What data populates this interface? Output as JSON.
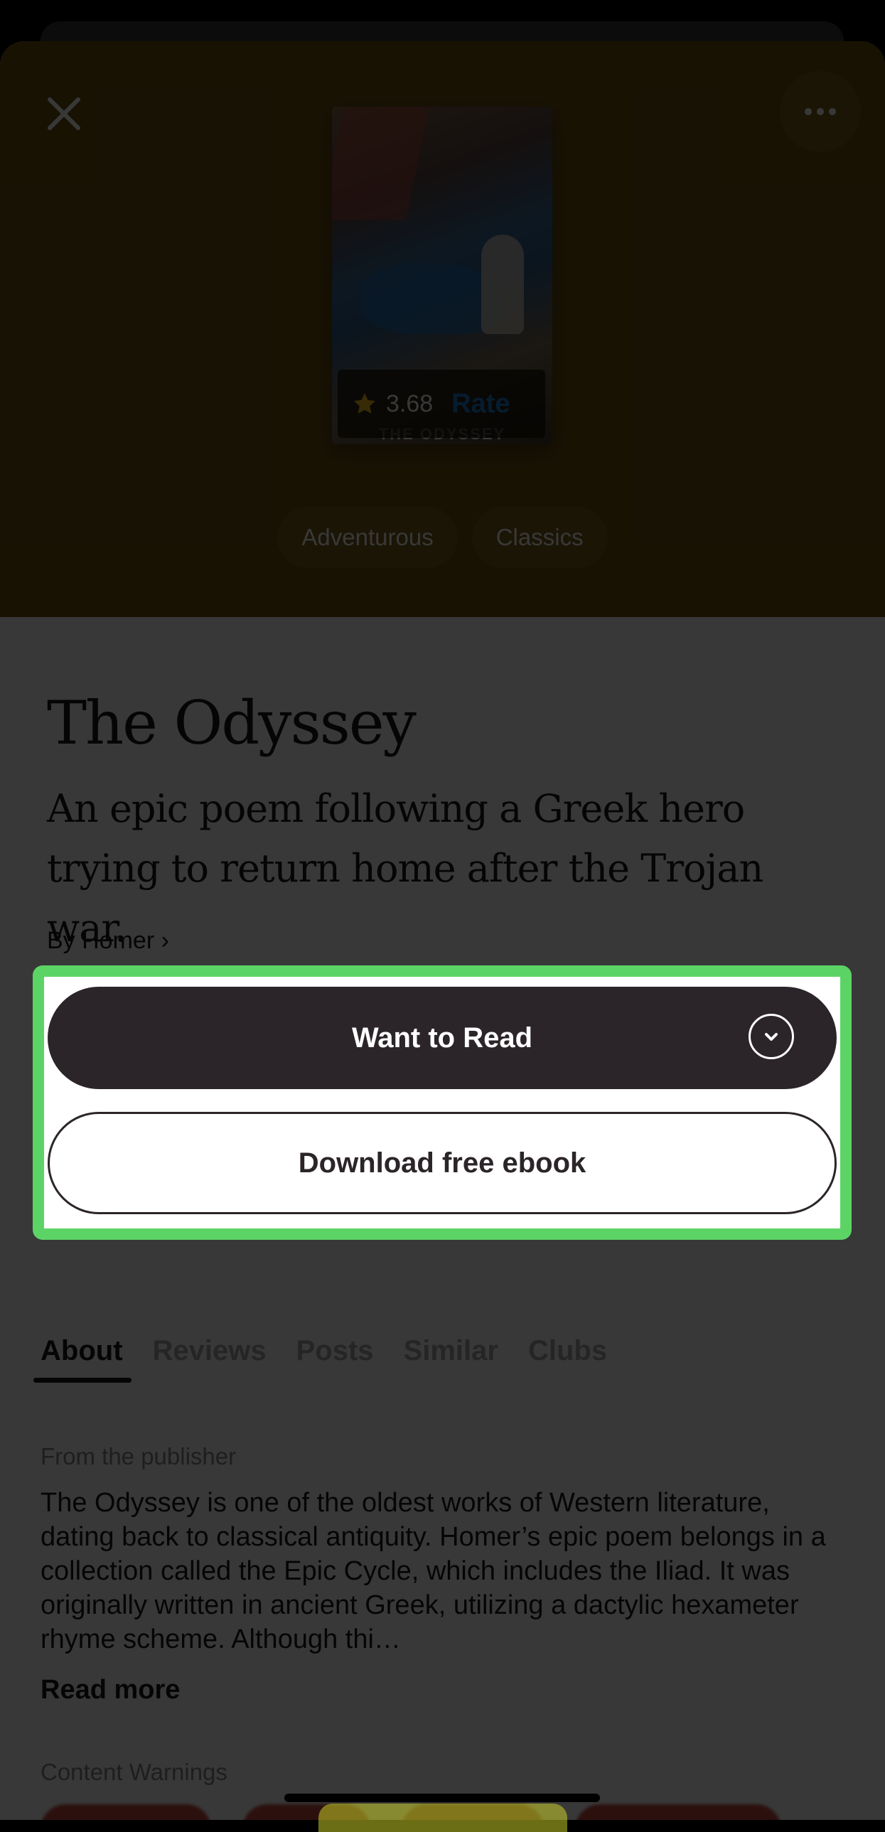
{
  "book": {
    "title": "The Odyssey",
    "description": "An epic poem following a Greek hero trying to return home after the Trojan war.",
    "author_link": "By Homer ›",
    "cover_title": "THE ODYSSEY",
    "rating": "3.68",
    "rate_label": "Rate"
  },
  "genres": [
    "Adventurous",
    "Classics"
  ],
  "actions": {
    "want_to_read": "Want to Read",
    "download": "Download free ebook"
  },
  "tabs": [
    "About",
    "Reviews",
    "Posts",
    "Similar",
    "Clubs"
  ],
  "active_tab": "About",
  "about": {
    "publisher_label": "From the publisher",
    "publisher_text": "The Odyssey is one of the oldest works of Western literature, dating back to classical antiquity. Homer’s epic poem belongs in a collection called the Epic Cycle, which includes the Iliad. It was originally written in ancient Greek, utilizing a dactylic hexameter rhyme scheme. Although thi…",
    "read_more": "Read more",
    "content_warnings_label": "Content Warnings"
  },
  "colors": {
    "hero": "#6e5410",
    "primary_button": "#2b2529",
    "highlight": "#5cd465",
    "rate_link": "#1d7fd0"
  }
}
